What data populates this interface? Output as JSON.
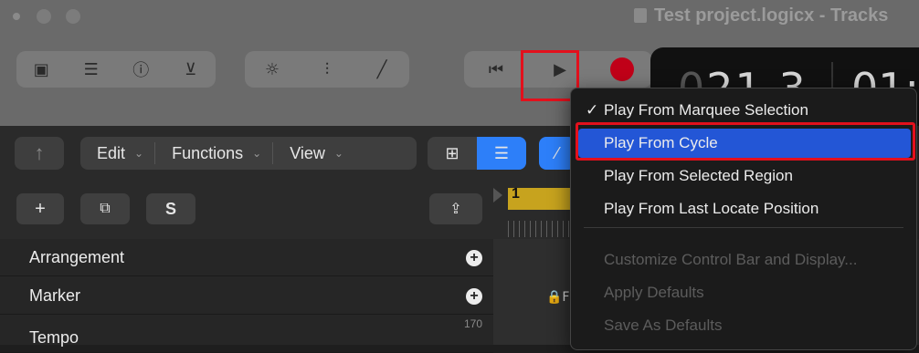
{
  "window": {
    "title": "Test project.logicx - Tracks"
  },
  "control_bar": {
    "left_icons": [
      "library-icon",
      "toggle-icon",
      "help-icon",
      "inbox-icon"
    ],
    "mid_icons": [
      "tuner-icon",
      "mixer-icon",
      "pencil-icon"
    ],
    "transport_icons": [
      "go-to-start-icon",
      "play-icon",
      "record-icon"
    ],
    "lcd_bar": "21",
    "lcd_beat": "3",
    "lcd_prefix": "0",
    "lcd_time": "01:"
  },
  "toolbar": {
    "back_icon": "up-arrow-icon",
    "menus": [
      {
        "label": "Edit"
      },
      {
        "label": "Functions"
      },
      {
        "label": "View"
      }
    ]
  },
  "track_header": {
    "add_label": "+",
    "solo_label": "S",
    "rows": [
      {
        "label": "Arrangement",
        "has_add": true
      },
      {
        "label": "Marker",
        "has_add": true
      },
      {
        "label": "Tempo",
        "value": "170"
      }
    ]
  },
  "ruler": {
    "bar_number": "1"
  },
  "timeline": {
    "lock_label": "🔒F"
  },
  "play_menu": {
    "items": [
      {
        "label": "Play From Marquee Selection",
        "checked": true,
        "enabled": true,
        "selected": false
      },
      {
        "label": "Play From Cycle",
        "checked": false,
        "enabled": true,
        "selected": true
      },
      {
        "label": "Play From Selected Region",
        "checked": false,
        "enabled": true,
        "selected": false
      },
      {
        "label": "Play From Last Locate Position",
        "checked": false,
        "enabled": true,
        "selected": false
      },
      {
        "label": "Customize Control Bar and Display...",
        "checked": false,
        "enabled": false,
        "selected": false
      },
      {
        "label": "Apply Defaults",
        "checked": false,
        "enabled": false,
        "selected": false
      },
      {
        "label": "Save As Defaults",
        "checked": false,
        "enabled": false,
        "selected": false
      }
    ],
    "check_mark": "✓"
  },
  "colors": {
    "accent": "#2d7ff9",
    "menu_selection": "#2356d6",
    "highlight_box": "#e3101c",
    "record": "#c00018",
    "ruler_cycle": "#c7a31e"
  }
}
